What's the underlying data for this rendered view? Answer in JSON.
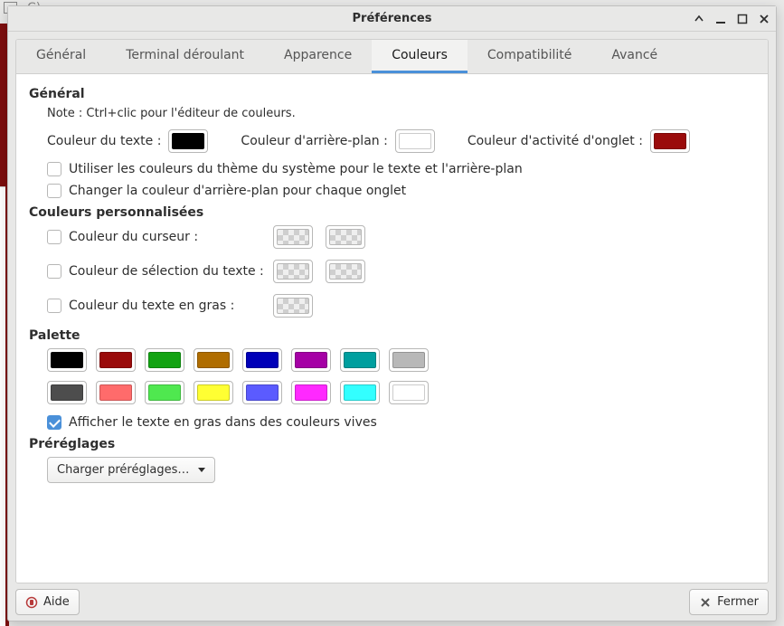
{
  "backdrop_text": "C)",
  "window": {
    "title": "Préférences"
  },
  "tabs": [
    {
      "label": "Général"
    },
    {
      "label": "Terminal déroulant"
    },
    {
      "label": "Apparence"
    },
    {
      "label": "Couleurs"
    },
    {
      "label": "Compatibilité"
    },
    {
      "label": "Avancé"
    }
  ],
  "general": {
    "heading": "Général",
    "note": "Note : Ctrl+clic pour l'éditeur de couleurs.",
    "text_color_label": "Couleur du texte :",
    "text_color": "#000000",
    "bg_color_label": "Couleur d'arrière-plan :",
    "bg_color": "#ffffff",
    "tab_activity_label": "Couleur d'activité d'onglet :",
    "tab_activity_color": "#9a0b0b",
    "use_system_label": "Utiliser les couleurs du thème du système pour le texte et l'arrière-plan",
    "vary_bg_label": "Changer la couleur d'arrière-plan pour chaque onglet"
  },
  "custom": {
    "heading": "Couleurs personnalisées",
    "cursor_label": "Couleur du curseur :",
    "selection_label": "Couleur de sélection du texte :",
    "bold_label": "Couleur du texte en gras :"
  },
  "palette": {
    "heading": "Palette",
    "row1": [
      "#000000",
      "#9a0b0b",
      "#12a312",
      "#b06d00",
      "#0000b8",
      "#a500a5",
      "#009f9f",
      "#b8b8b8"
    ],
    "row2": [
      "#4d4d4d",
      "#ff6b6b",
      "#4fe84f",
      "#ffff33",
      "#5b5bff",
      "#ff29ff",
      "#33ffff",
      "#ffffff"
    ],
    "bold_bright_label": "Afficher le texte en gras dans des couleurs vives"
  },
  "presets": {
    "heading": "Préréglages",
    "load_label": "Charger préréglages…"
  },
  "actions": {
    "help": "Aide",
    "close": "Fermer"
  }
}
